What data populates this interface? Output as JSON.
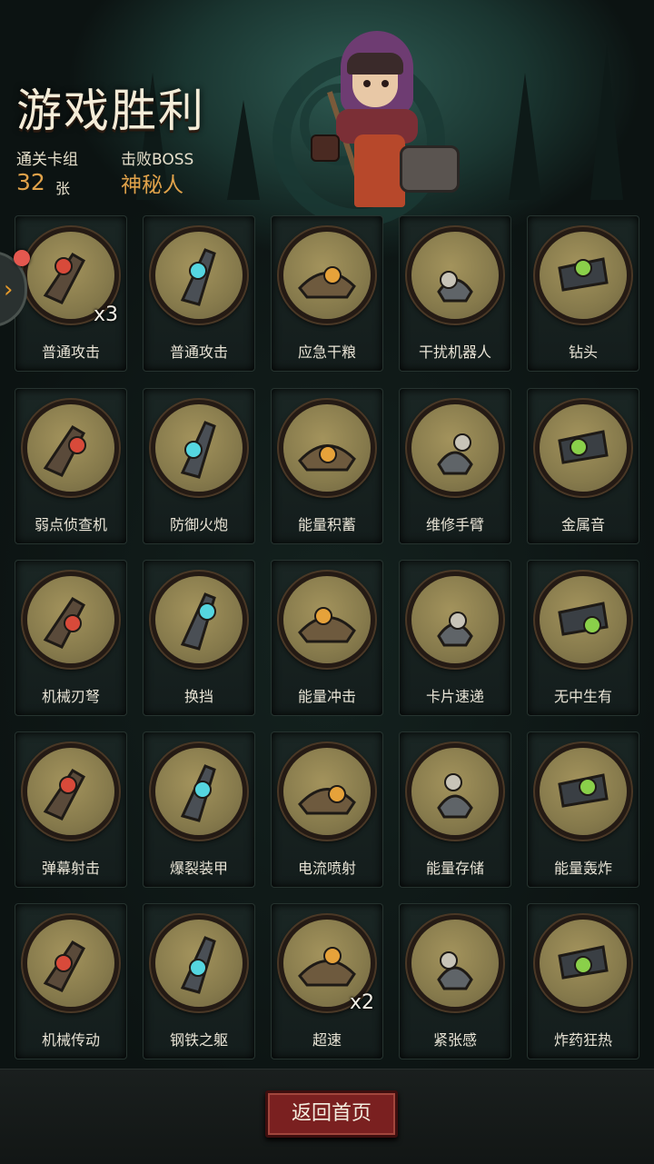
{
  "header": {
    "title": "游戏胜利",
    "deck_label": "通关卡组",
    "deck_count": "32",
    "deck_unit": "张",
    "boss_label": "击败BOSS",
    "boss_name": "神秘人"
  },
  "colors": {
    "accent_orange": "#e0a24a",
    "card_disc": "#867a4c",
    "button_red": "#7a2020",
    "notification": "#e4584f"
  },
  "cards": [
    {
      "name": "普通攻击",
      "count": "x3",
      "icon": "claw-hammer-icon"
    },
    {
      "name": "普通攻击",
      "count": "",
      "icon": "pliers-icon"
    },
    {
      "name": "应急干粮",
      "count": "",
      "icon": "rations-icon"
    },
    {
      "name": "干扰机器人",
      "count": "",
      "icon": "jammer-robot-icon"
    },
    {
      "name": "钻头",
      "count": "",
      "icon": "drill-icon"
    },
    {
      "name": "弱点侦查机",
      "count": "",
      "icon": "scout-drone-icon"
    },
    {
      "name": "防御火炮",
      "count": "",
      "icon": "cannon-icon"
    },
    {
      "name": "能量积蓄",
      "count": "",
      "icon": "energy-core-icon"
    },
    {
      "name": "维修手臂",
      "count": "",
      "icon": "repair-arm-icon"
    },
    {
      "name": "金属音",
      "count": "",
      "icon": "horn-icon"
    },
    {
      "name": "机械刃弩",
      "count": "",
      "icon": "blade-crossbow-icon"
    },
    {
      "name": "换挡",
      "count": "",
      "icon": "gear-shift-icon"
    },
    {
      "name": "能量冲击",
      "count": "",
      "icon": "energy-shock-icon"
    },
    {
      "name": "卡片速递",
      "count": "",
      "icon": "card-express-icon"
    },
    {
      "name": "无中生有",
      "count": "",
      "icon": "summon-icon"
    },
    {
      "name": "弹幕射击",
      "count": "",
      "icon": "barrage-icon"
    },
    {
      "name": "爆裂装甲",
      "count": "",
      "icon": "burst-armor-icon"
    },
    {
      "name": "电流喷射",
      "count": "",
      "icon": "current-jet-icon"
    },
    {
      "name": "能量存储",
      "count": "",
      "icon": "energy-storage-icon"
    },
    {
      "name": "能量轰炸",
      "count": "",
      "icon": "energy-bomb-icon"
    },
    {
      "name": "机械传动",
      "count": "",
      "icon": "transmission-icon"
    },
    {
      "name": "钢铁之躯",
      "count": "",
      "icon": "steel-body-icon"
    },
    {
      "name": "超速",
      "count": "x2",
      "icon": "overspeed-icon"
    },
    {
      "name": "紧张感",
      "count": "",
      "icon": "dynamite-icon"
    },
    {
      "name": "炸药狂热",
      "count": "",
      "icon": "explosive-frenzy-icon"
    }
  ],
  "footer": {
    "return_label": "返回首页"
  }
}
